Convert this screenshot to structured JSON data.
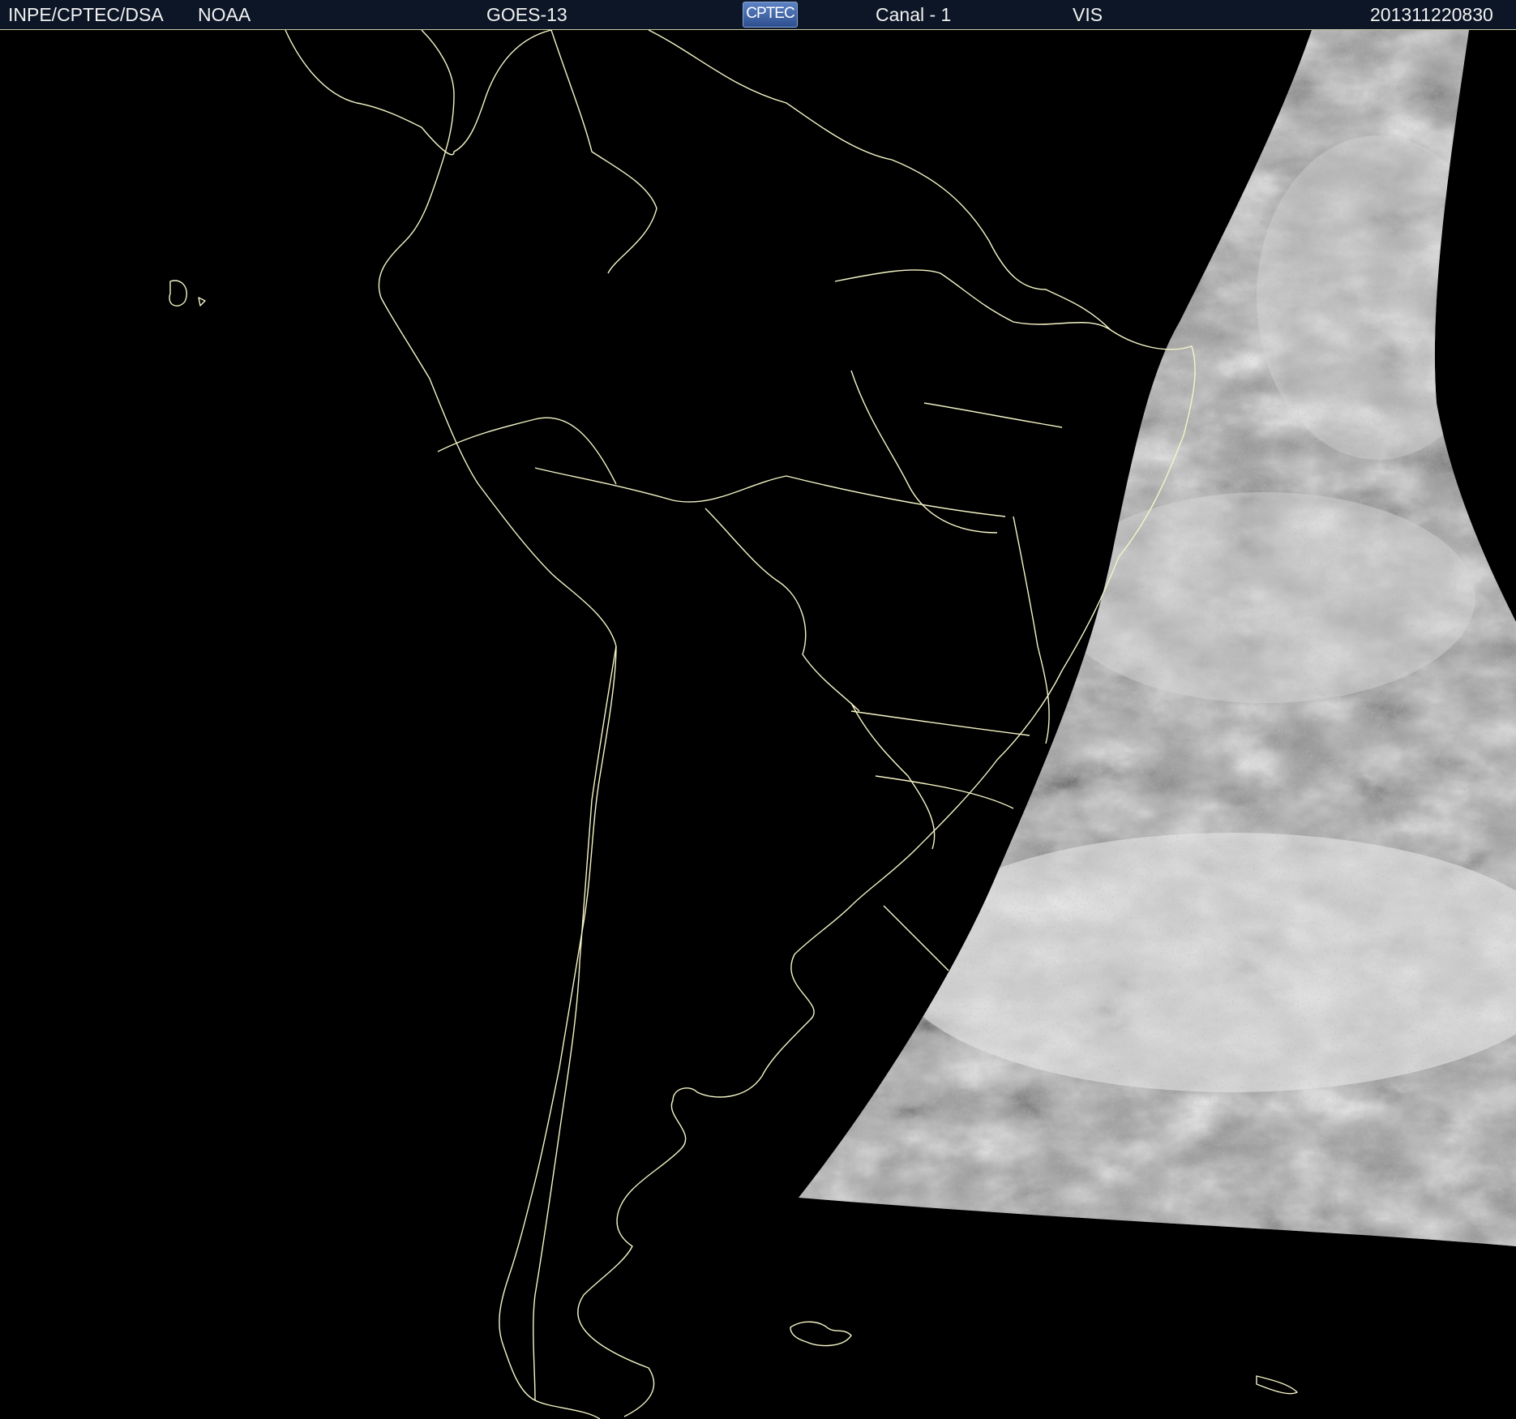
{
  "header": {
    "agency": "INPE/CPTEC/DSA",
    "source": "NOAA",
    "satellite": "GOES-13",
    "logo_text": "CPTEC",
    "channel": "Canal - 1",
    "band": "VIS",
    "timestamp": "201311220830"
  },
  "map": {
    "region": "South America",
    "background_color": "#000000",
    "boundary_color": "#f5f5c8",
    "imagery": "visible-channel cloud imagery (grayscale), eastern swath"
  }
}
